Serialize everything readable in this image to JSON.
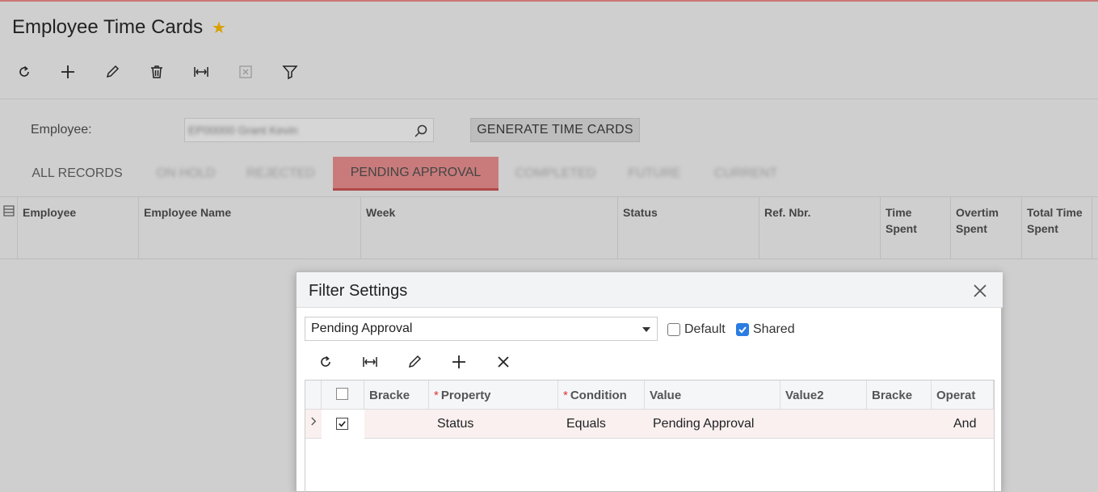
{
  "page": {
    "title": "Employee Time Cards",
    "favorite_icon": "star-icon"
  },
  "toolbar": [
    {
      "name": "refresh-icon"
    },
    {
      "name": "add-icon"
    },
    {
      "name": "edit-icon"
    },
    {
      "name": "delete-icon"
    },
    {
      "name": "fit-to-screen-icon"
    },
    {
      "name": "export-excel-icon"
    },
    {
      "name": "filter-icon"
    }
  ],
  "form": {
    "employee_label": "Employee:",
    "employee_value": "EP00000 Grant Kevin",
    "generate_button": "GENERATE TIME CARDS"
  },
  "tabs": [
    {
      "label": "ALL RECORDS",
      "active": false,
      "blurred": false
    },
    {
      "label": "ON HOLD",
      "active": false,
      "blurred": true
    },
    {
      "label": "REJECTED",
      "active": false,
      "blurred": true
    },
    {
      "label": "PENDING APPROVAL",
      "active": true,
      "blurred": false
    },
    {
      "label": "COMPLETED",
      "active": false,
      "blurred": true
    },
    {
      "label": "FUTURE",
      "active": false,
      "blurred": true
    },
    {
      "label": "CURRENT",
      "active": false,
      "blurred": true
    }
  ],
  "grid": {
    "columns": [
      "Employee",
      "Employee Name",
      "Week",
      "Status",
      "Ref. Nbr.",
      "Time Spent",
      "Overtim Spent",
      "Total Time Spent"
    ]
  },
  "filter_dialog": {
    "title": "Filter Settings",
    "selected_filter": "Pending Approval",
    "default_label": "Default",
    "default_checked": false,
    "shared_label": "Shared",
    "shared_checked": true,
    "columns": {
      "bracket_open": "Bracke",
      "property": "Property",
      "condition": "Condition",
      "value": "Value",
      "value2": "Value2",
      "bracket_close": "Bracke",
      "operator": "Operat"
    },
    "rows": [
      {
        "active": true,
        "property": "Status",
        "condition": "Equals",
        "value": "Pending Approval",
        "value2": "",
        "operator": "And"
      }
    ]
  },
  "colors": {
    "accent_tab": "#c97b7b",
    "accent_tab_border": "#b04848",
    "checkbox_blue": "#2a7de1",
    "star": "#d9a000"
  }
}
